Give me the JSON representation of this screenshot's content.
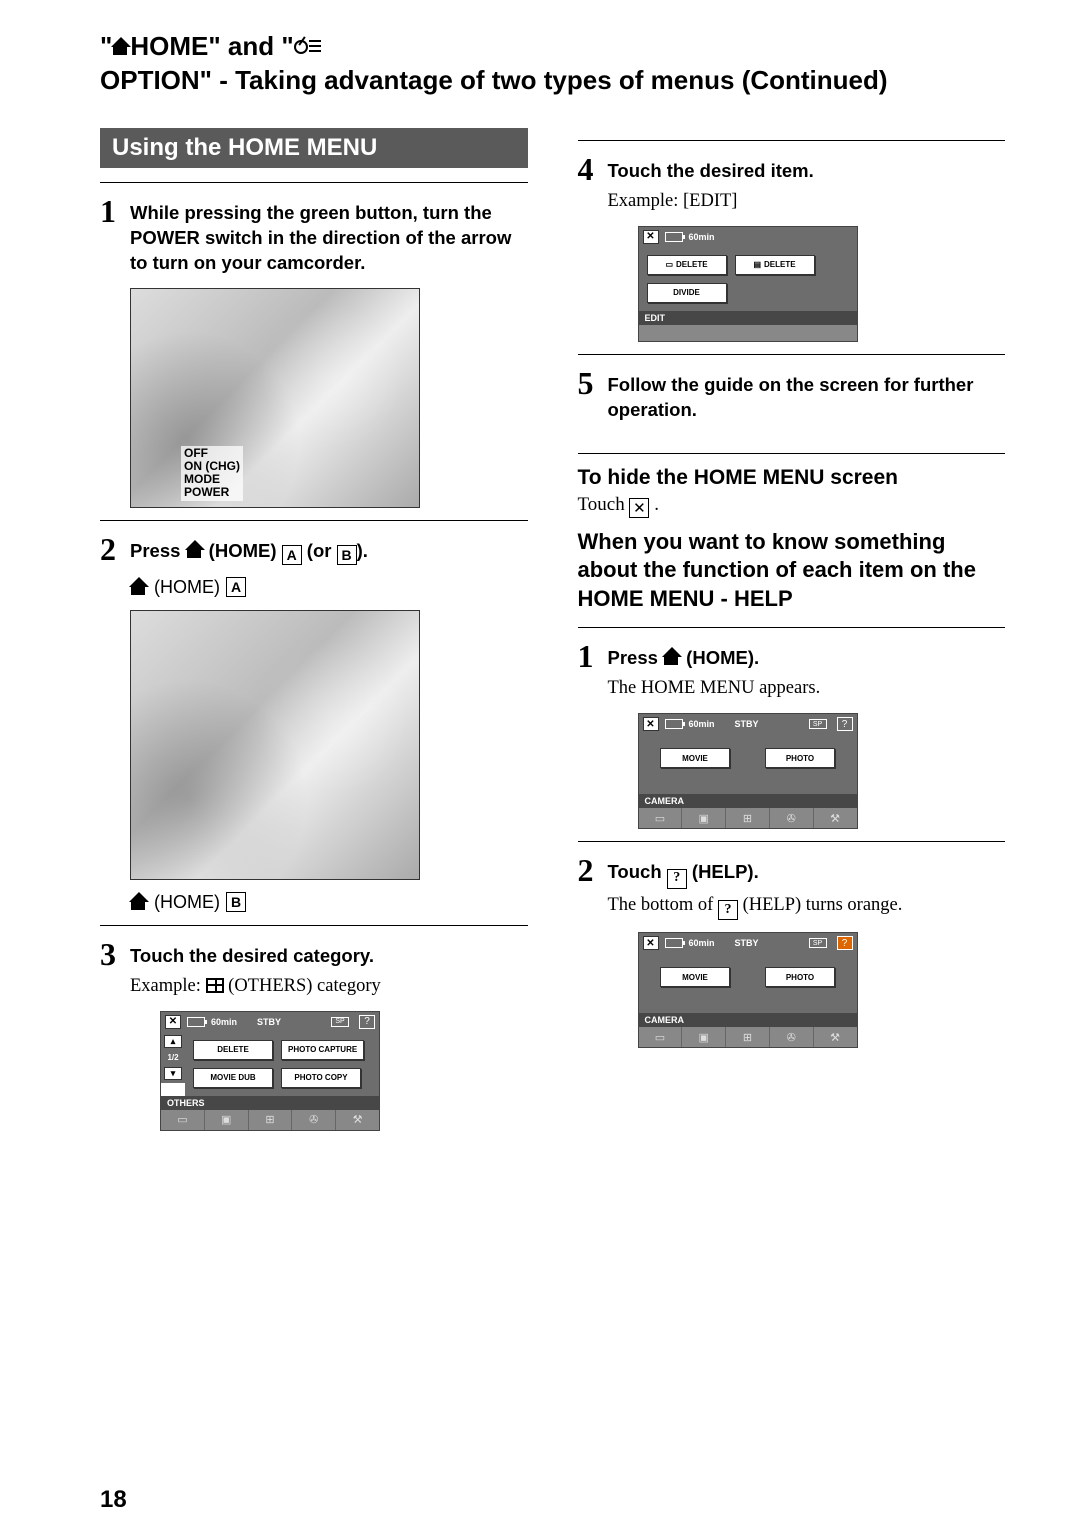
{
  "title_p1": "\"",
  "title_p2": "HOME\" and \"",
  "title_p3": "OPTION\" - Taking advantage of two types of menus (Continued)",
  "section1": "Using the HOME MENU",
  "step1": "While pressing the green button, turn the POWER switch in the direction of the arrow to turn on your camcorder.",
  "illus1_label": "OFF\nON (CHG)\nMODE\nPOWER",
  "step2_pre": "Press ",
  "step2_mid": " (HOME) ",
  "step2_or": " (or ",
  "step2_end": ").",
  "home_a": " (HOME) ",
  "home_b": " (HOME) ",
  "step3": "Touch the desired category.",
  "step3_example_pre": "Example: ",
  "step3_example_post": " (OTHERS) category",
  "mini_others": {
    "t60": "60min",
    "stby": "STBY",
    "sp": "SP",
    "btns": [
      "DELETE",
      "PHOTO CAPTURE",
      "MOVIE DUB",
      "PHOTO COPY"
    ],
    "page": "1/2",
    "cat": "OTHERS"
  },
  "step4": "Touch the desired item.",
  "step4_example": "Example: [EDIT]",
  "mini_edit": {
    "t60": "60min",
    "del1": "DELETE",
    "del2": "DELETE",
    "div": "DIVIDE",
    "cat": "EDIT"
  },
  "step5": "Follow the guide on the screen for further operation.",
  "hide_head": "To hide the HOME MENU screen",
  "hide_pre": "Touch ",
  "hide_post": ".",
  "help_head": "When you want to know something about the function of each item on the HOME MENU - HELP",
  "h1_pre": "Press ",
  "h1_post": " (HOME).",
  "h1_body": "The HOME MENU appears.",
  "mini_home": {
    "t60": "60min",
    "stby": "STBY",
    "sp": "SP",
    "movie": "MOVIE",
    "photo": "PHOTO",
    "cat": "CAMERA"
  },
  "h2_pre": "Touch ",
  "h2_post": " (HELP).",
  "h2_body_pre": "The bottom of ",
  "h2_body_post": " (HELP) turns orange.",
  "page_num": "18"
}
